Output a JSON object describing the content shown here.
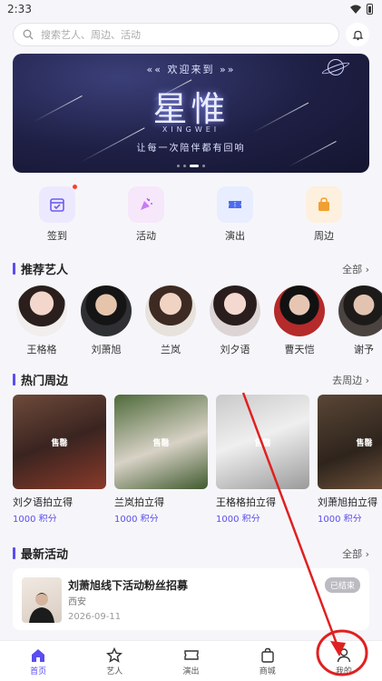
{
  "status": {
    "time": "2:33"
  },
  "search": {
    "placeholder": "搜索艺人、周边、活动"
  },
  "banner": {
    "top_text": "«« 欢迎来到 »»",
    "title": "星惟",
    "subtitle": "XINGWEI",
    "slogan": "让每一次陪伴都有回响"
  },
  "quick_actions": [
    {
      "label": "签到",
      "icon": "calendar-check-icon",
      "bg": "#ece9ff",
      "color": "#6c5cf0",
      "badge": true
    },
    {
      "label": "活动",
      "icon": "party-popper-icon",
      "bg": "#f6e7fb",
      "color": "#b05cf0",
      "badge": false
    },
    {
      "label": "演出",
      "icon": "ticket-icon",
      "bg": "#e8edff",
      "color": "#4c6cf0",
      "badge": false
    },
    {
      "label": "周边",
      "icon": "shopping-bag-icon",
      "bg": "#fdf0de",
      "color": "#f0a030",
      "badge": false
    }
  ],
  "artists_section": {
    "title": "推荐艺人",
    "more": "全部 ›"
  },
  "artists": [
    {
      "name": "王格格"
    },
    {
      "name": "刘萧旭"
    },
    {
      "name": "兰岚"
    },
    {
      "name": "刘夕语"
    },
    {
      "name": "曹天恺"
    },
    {
      "name": "谢予"
    }
  ],
  "goods_section": {
    "title": "热门周边",
    "more": "去周边 ›"
  },
  "goods": [
    {
      "name": "刘夕语拍立得",
      "price": "1000 积分",
      "tag": "售罄"
    },
    {
      "name": "兰岚拍立得",
      "price": "1000 积分",
      "tag": "售罄"
    },
    {
      "name": "王格格拍立得",
      "price": "1000 积分",
      "tag": "售罄"
    },
    {
      "name": "刘萧旭拍立得",
      "price": "1000 积分",
      "tag": "售罄"
    }
  ],
  "events_section": {
    "title": "最新活动",
    "more": "全部 ›"
  },
  "events": [
    {
      "title": "刘萧旭线下活动粉丝招募",
      "location": "西安",
      "date": "2026-09-11",
      "status": "已结束"
    }
  ],
  "tabs": [
    {
      "label": "首页",
      "icon": "home-icon",
      "active": true
    },
    {
      "label": "艺人",
      "icon": "star-icon",
      "active": false
    },
    {
      "label": "演出",
      "icon": "ticket-icon",
      "active": false
    },
    {
      "label": "商城",
      "icon": "shopping-bag-icon",
      "active": false
    },
    {
      "label": "我的",
      "icon": "person-icon",
      "active": false
    }
  ],
  "colors": {
    "accent": "#5b4ef0",
    "annotation": "#e02020"
  }
}
